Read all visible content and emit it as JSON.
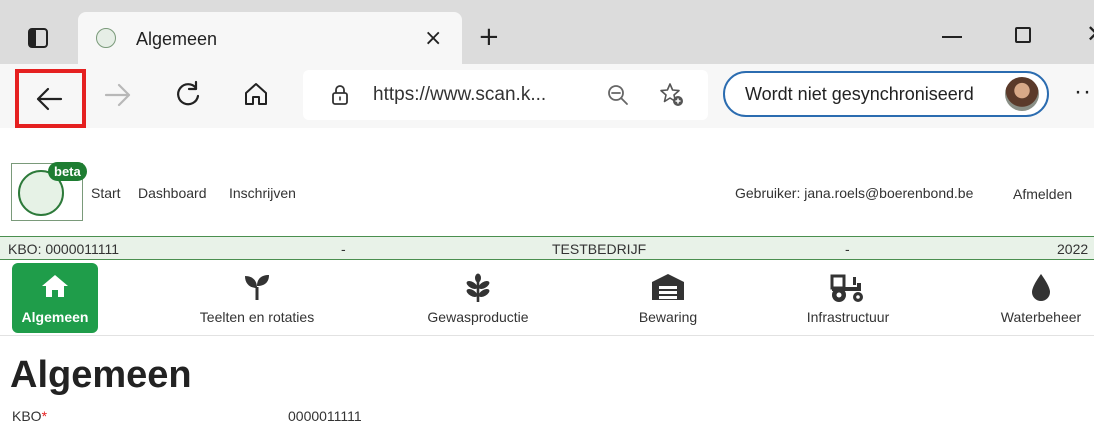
{
  "browser": {
    "tab_title": "Algemeen",
    "tab_close": "×",
    "new_tab": "+",
    "url": "https://www.scan.k...",
    "sync_label": "Wordt niet gesynchroniseerd",
    "more": "···",
    "accent": "#2b6cb0",
    "highlight": "#e52020"
  },
  "site": {
    "logo_badge": "beta",
    "nav": [
      "Start",
      "Dashboard",
      "Inschrijven"
    ],
    "user": "Gebruiker: jana.roels@boerenbond.be",
    "logout": "Afmelden"
  },
  "infobar": {
    "kbo": "KBO: 0000011111",
    "sep1": "-",
    "company": "TESTBEDRIJF",
    "sep2": "-",
    "year": "2022"
  },
  "tiles": [
    {
      "label": "Algemeen",
      "icon": "home-icon",
      "active": true
    },
    {
      "label": "Teelten en rotaties",
      "icon": "sprout-icon"
    },
    {
      "label": "Gewasproductie",
      "icon": "plant-icon"
    },
    {
      "label": "Bewaring",
      "icon": "warehouse-icon"
    },
    {
      "label": "Infrastructuur",
      "icon": "tractor-icon"
    },
    {
      "label": "Waterbeheer",
      "icon": "water-drop-icon"
    }
  ],
  "page": {
    "title": "Algemeen",
    "field_label": "KBO",
    "field_required": "*",
    "field_value": "0000011111"
  },
  "colors": {
    "active_tile": "#1f9d4a",
    "infobar_bg": "#e8f2e8"
  }
}
